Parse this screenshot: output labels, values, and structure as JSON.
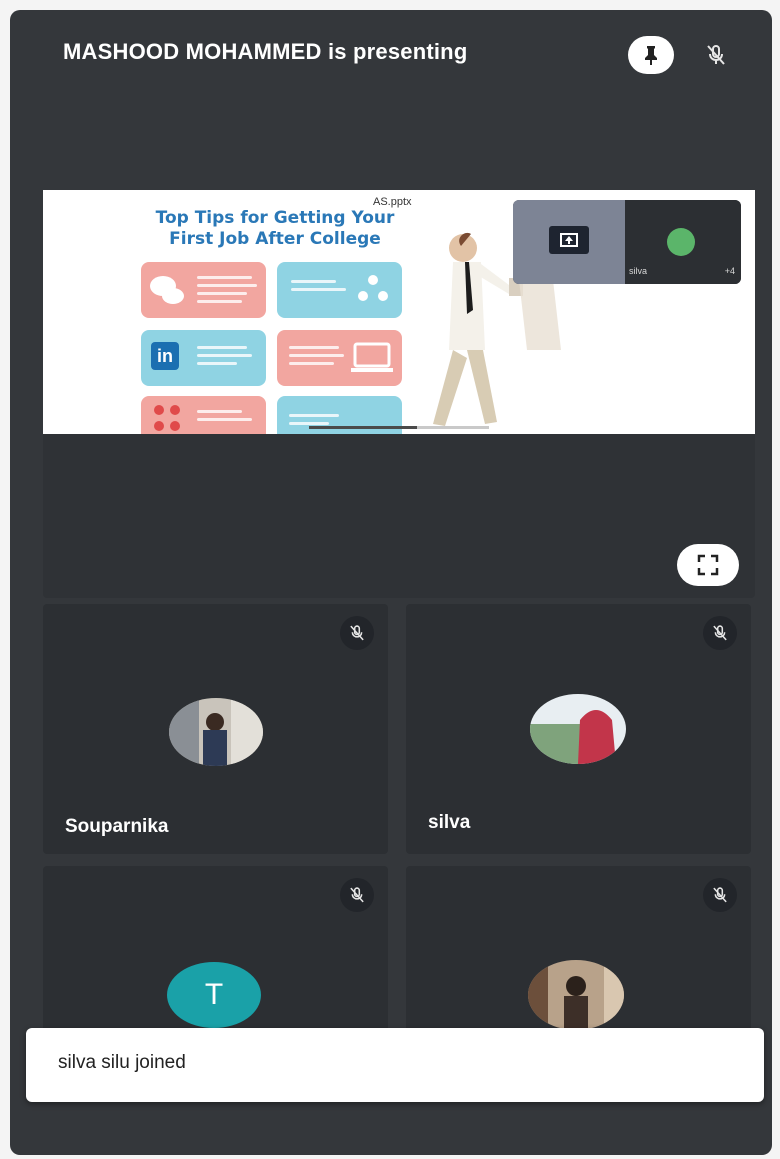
{
  "header": {
    "title": "MASHOOD MOHAMMED is presenting",
    "pin_icon": "pin-icon",
    "mute_icon": "mic-off-icon"
  },
  "presentation": {
    "file_name": "AS.pptx",
    "slide_title_line1": "Top Tips for Getting Your",
    "slide_title_line2": "First Job After College",
    "linkedin_glyph": "in",
    "thumbnail_name": "silva",
    "thumbnail_count": "+4",
    "progress": 0.6
  },
  "participants": [
    {
      "name": "Souparnika",
      "muted": true,
      "avatar": "photo"
    },
    {
      "name": "silva",
      "muted": true,
      "avatar": "photo"
    },
    {
      "name": "",
      "muted": true,
      "avatar_letter": "T"
    },
    {
      "name": "",
      "muted": true,
      "avatar": "photo"
    }
  ],
  "toast": {
    "message": "silva silu joined"
  },
  "colors": {
    "background": "#34373b",
    "tile": "#2c2f33",
    "slide_title": "#2a78b7",
    "letter_avatar": "#1aa1a8"
  }
}
